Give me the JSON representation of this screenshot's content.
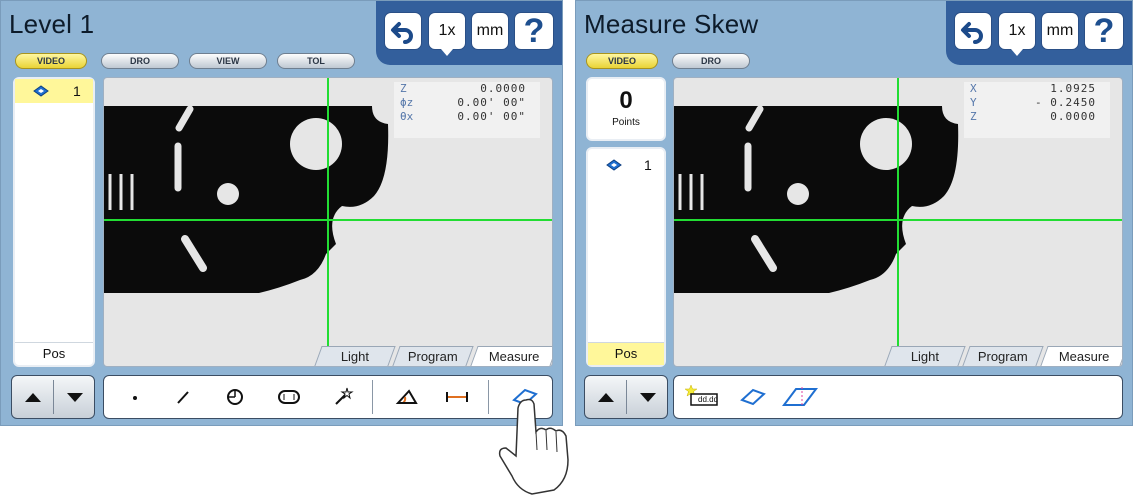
{
  "left": {
    "title": "Level 1",
    "top_buttons": {
      "undo_icon": "undo-icon",
      "magnification": "1x",
      "units": "mm",
      "help": "?"
    },
    "mode_buttons": [
      "VIDEO",
      "DRO",
      "VIEW",
      "TOL"
    ],
    "active_mode": "VIDEO",
    "list_items": [
      {
        "icon": "skew-diamond-icon",
        "number": "1"
      }
    ],
    "pos_label": "Pos",
    "readout": [
      {
        "label": "Z",
        "value": "0.0000"
      },
      {
        "label": "ϕz",
        "value": "0.00' 00\""
      },
      {
        "label": "θx",
        "value": "0.00' 00\""
      }
    ],
    "tabs": [
      "Light",
      "Program",
      "Measure"
    ],
    "active_tab": "Measure",
    "tools": [
      "point-tool-icon",
      "line-tool-icon",
      "circle-tool-icon",
      "slot-tool-icon",
      "autofeature-wand-icon",
      "angle-tool-icon",
      "distance-tool-icon",
      "skew-tool-icon"
    ]
  },
  "right": {
    "title": "Measure Skew",
    "top_buttons": {
      "undo_icon": "undo-icon",
      "magnification": "1x",
      "units": "mm",
      "help": "?"
    },
    "mode_buttons": [
      "VIDEO",
      "DRO"
    ],
    "active_mode": "VIDEO",
    "points": {
      "count": "0",
      "label": "Points"
    },
    "list_items": [
      {
        "icon": "skew-diamond-icon",
        "number": "1"
      }
    ],
    "pos_label": "Pos",
    "readout": [
      {
        "label": "X",
        "value": "1.0925"
      },
      {
        "label": "Y",
        "value": "- 0.2450"
      },
      {
        "label": "Z",
        "value": "0.0000"
      }
    ],
    "tabs": [
      "Light",
      "Program",
      "Measure"
    ],
    "active_tab": "Measure",
    "tools": [
      {
        "icon": "new-reference-icon",
        "text": "dd.dd"
      },
      {
        "icon": "skew-tool-icon"
      },
      {
        "icon": "skew-parallelogram-icon"
      }
    ]
  },
  "colors": {
    "panel": "#8fb4d4",
    "header": "#335f9c",
    "crosshair": "#22dd33",
    "active_button": "#fff79a",
    "part": "#0b0b0b"
  }
}
